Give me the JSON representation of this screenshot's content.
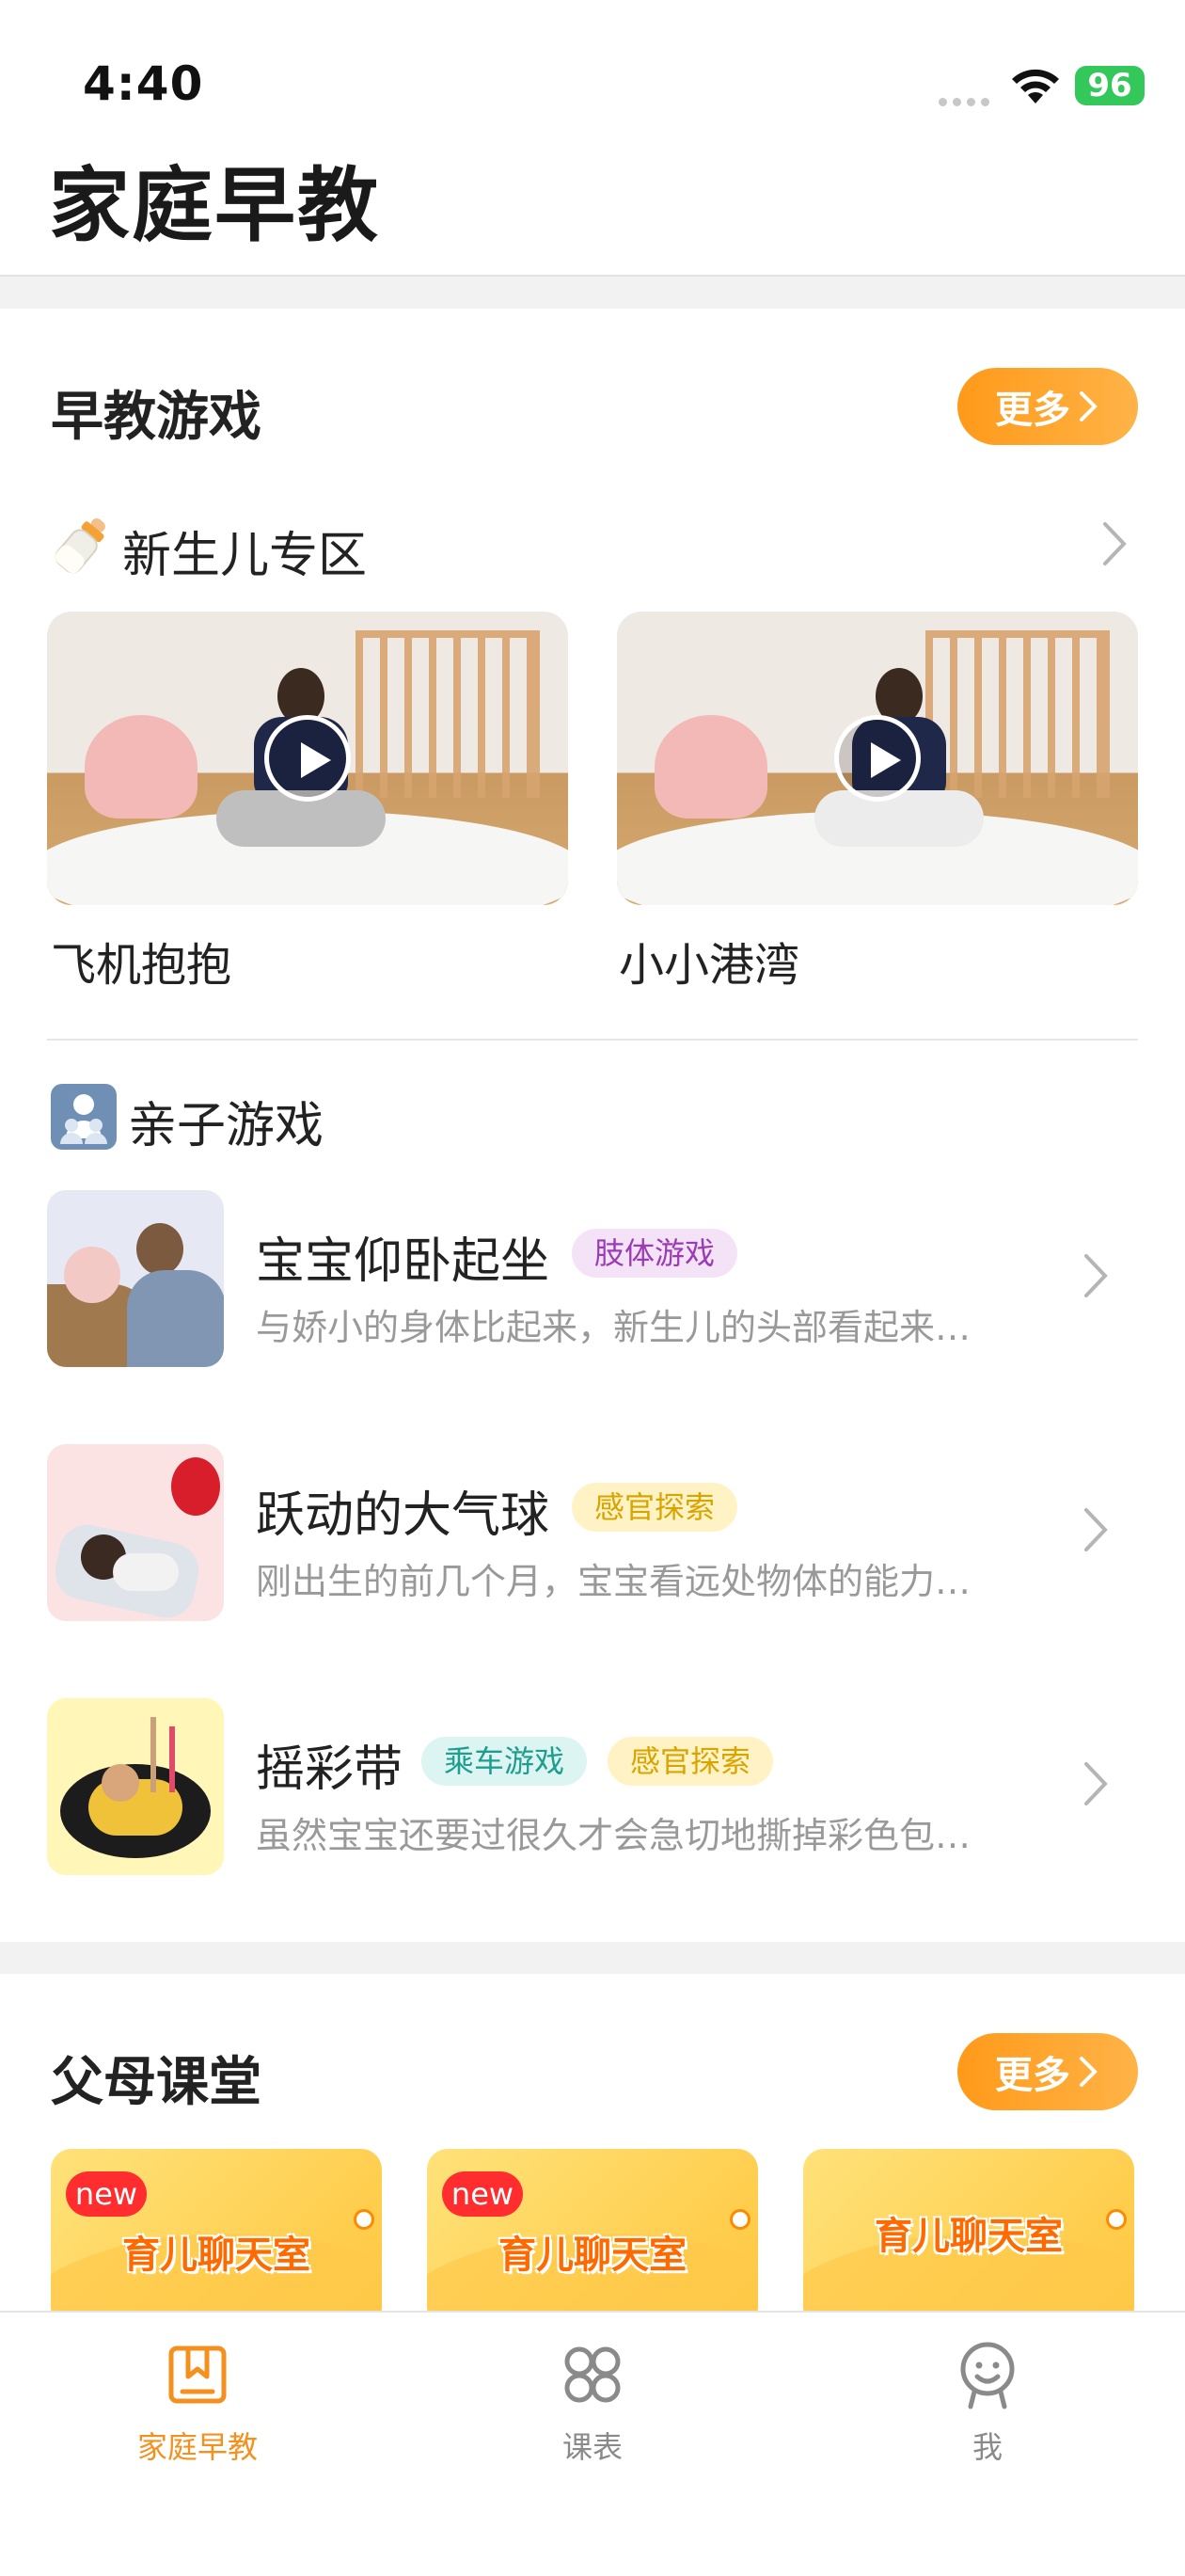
{
  "status_bar": {
    "time": "4:40",
    "battery": "96"
  },
  "app": {
    "title": "家庭早教"
  },
  "early_games": {
    "title": "早教游戏",
    "more_label": "更多",
    "newborn": {
      "icon": "baby-bottle-icon",
      "title": "新生儿专区",
      "videos": [
        {
          "caption": "飞机抱抱"
        },
        {
          "caption": "小小港湾"
        }
      ]
    },
    "parent_child": {
      "icon": "family-icon",
      "title": "亲子游戏",
      "items": [
        {
          "title": "宝宝仰卧起坐",
          "tags": [
            "肢体游戏"
          ],
          "desc": "与娇小的身体比起来，新生儿的头部看起来…"
        },
        {
          "title": "跃动的大气球",
          "tags": [
            "感官探索"
          ],
          "desc": "刚出生的前几个月，宝宝看远处物体的能力…"
        },
        {
          "title": "摇彩带",
          "tags": [
            "乘车游戏",
            "感官探索"
          ],
          "desc": "虽然宝宝还要过很久才会急切地撕掉彩色包…"
        }
      ]
    }
  },
  "parent_class": {
    "title": "父母课堂",
    "more_label": "更多",
    "cards": [
      {
        "badge": "new",
        "text": "育儿聊天室"
      },
      {
        "badge": "new",
        "text": "育儿聊天室"
      },
      {
        "badge": "",
        "text": "育儿聊天室"
      }
    ]
  },
  "tabbar": {
    "active_color": "#f5901e",
    "inactive_color": "#8a8a8a",
    "tabs": [
      {
        "label": "家庭早教",
        "icon": "bookmark-box-icon",
        "active": true
      },
      {
        "label": "课表",
        "icon": "grid-circles-icon",
        "active": false
      },
      {
        "label": "我",
        "icon": "smiley-user-icon",
        "active": false
      }
    ]
  }
}
